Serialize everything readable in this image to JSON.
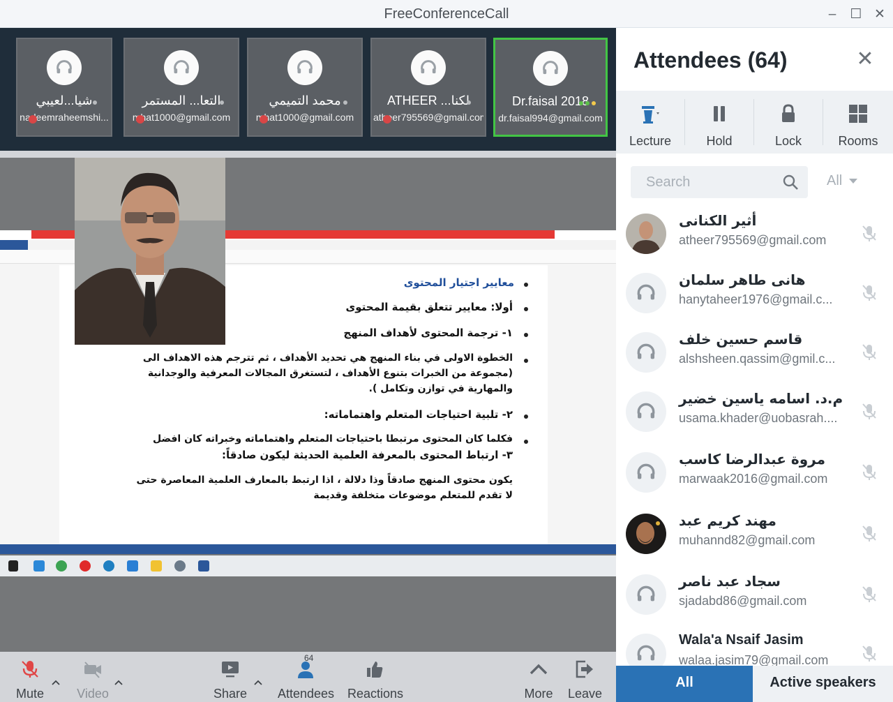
{
  "window": {
    "title": "FreeConferenceCall",
    "minimize_icon": "minimize-icon",
    "maximize_icon": "maximize-icon",
    "close_icon": "close-icon"
  },
  "thumbnails": [
    {
      "name": "شيا...لعيبي",
      "email": "nadeemraheemshi...",
      "icon": "headset-icon"
    },
    {
      "name": "التعا... المستمر",
      "email": "mhat1000@gmail.com",
      "icon": "headset-icon"
    },
    {
      "name": "محمد التميمي",
      "email": "mhat1000@gmail.com",
      "icon": "headset-icon"
    },
    {
      "name": "ATHEER ...لكنا",
      "email": "atheer795569@gmail.com",
      "icon": "headset-icon"
    },
    {
      "name": "Dr.faisal 2018",
      "email": "dr.faisal994@gmail.com",
      "icon": "headset-icon",
      "active": true
    }
  ],
  "slide": {
    "lines": [
      "معايير اجتيار المحتوى",
      "أولا: معايير تتعلق بقيمة المحتوى",
      "١- ترجمة المحتوى لأهداف المنهج",
      "الخطوة الاولى في بناء المنهج هي تحديد الأهداف ، ثم تترجم هذه الاهداف الى",
      "(مجموعة من الخبرات بتنوع الأهداف ، لتستغرق المجالات المعرفية والوجدانية",
      "والمهارية في توازن وتكامل ).",
      "٢- تلبية احتياجات المتعلم واهتماماته:",
      "فكلما كان المحتوى مرتبطا باحتياجات المتعلم واهتماماته وخبراته كان افضل",
      "٣- ارتباط المحتوى بالمعرفة العلمية الحديثة ليكون صادقاً:",
      "يكون محتوى المنهج صادقاً وذا دلالة ، اذا ارتبط بالمعارف العلمية المعاصرة حتى",
      "لا تقدم للمتعلم موضوعات متخلفة وقديمة"
    ]
  },
  "controls": {
    "mute": "Mute",
    "video": "Video",
    "share": "Share",
    "attendees": "Attendees",
    "attendees_count": "64",
    "reactions": "Reactions",
    "more": "More",
    "leave": "Leave"
  },
  "panel": {
    "title": "Attendees (64)",
    "tools": {
      "lecture": "Lecture",
      "hold": "Hold",
      "lock": "Lock",
      "rooms": "Rooms"
    },
    "search_placeholder": "Search",
    "filter": "All",
    "attendees": [
      {
        "name": "أثير الكنانى",
        "email": "atheer795569@gmail.com",
        "avatar": "photo"
      },
      {
        "name": "هانى طاهر سلمان",
        "email": "hanytaheer1976@gmail.c...",
        "avatar": "headset-icon"
      },
      {
        "name": "قاسم حسين خلف",
        "email": "alshsheen.qassim@gmil.c...",
        "avatar": "headset-icon"
      },
      {
        "name": "م.د. اسامه ياسين خضير",
        "email": "usama.khader@uobasrah....",
        "avatar": "headset-icon"
      },
      {
        "name": "مروة عبدالرضا كاسب",
        "email": "marwaak2016@gmail.com",
        "avatar": "headset-icon"
      },
      {
        "name": "مهند كريم عبد",
        "email": "muhannd82@gmail.com",
        "avatar": "photo"
      },
      {
        "name": "سجاد عبد ناصر",
        "email": "sjadabd86@gmail.com",
        "avatar": "headset-icon"
      },
      {
        "name": "Wala'a Nsaif Jasim",
        "email": "walaa.jasim79@gmail.com",
        "avatar": "headset-icon"
      }
    ],
    "tabs": {
      "all": "All",
      "active_speakers": "Active speakers"
    }
  },
  "colors": {
    "accent": "#2a72b5",
    "active_border": "#43c545",
    "mute_red": "#e04646",
    "thumb_bg": "#5b5f64",
    "strip_bg": "#1f2d3a"
  }
}
